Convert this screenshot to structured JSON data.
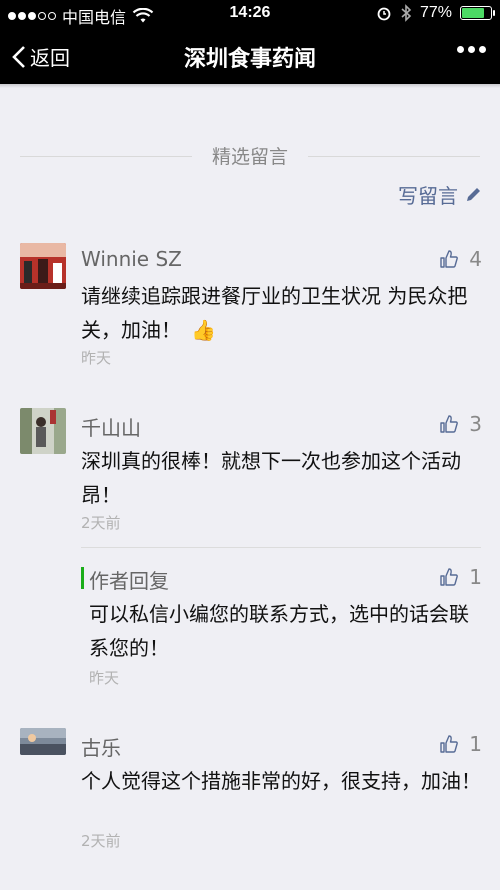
{
  "status_bar": {
    "carrier": "中国电信",
    "time": "14:26",
    "battery": "77%"
  },
  "nav": {
    "back_label": "返回",
    "title": "深圳食事药闻"
  },
  "section": {
    "title": "精选留言",
    "write_label": "写留言"
  },
  "comments": [
    {
      "name": "Winnie SZ",
      "likes": "4",
      "text": "请继续追踪跟进餐厅业的卫生状况 为民众把关，加油！",
      "emoji": "👍",
      "time": "昨天"
    },
    {
      "name": "千山山",
      "likes": "3",
      "text": "深圳真的很棒！就想下一次也参加这个活动昂！",
      "time": "2天前",
      "reply": {
        "label": "作者回复",
        "likes": "1",
        "text": "可以私信小编您的联系方式，选中的话会联系您的！",
        "time": "昨天"
      }
    },
    {
      "name": "古乐",
      "likes": "1",
      "text": "个人觉得这个措施非常的好，很支持，加油！",
      "time": "2天前"
    }
  ],
  "colors": {
    "link": "#576b95",
    "author_bar": "#1aad19",
    "battery": "#4cd964"
  }
}
